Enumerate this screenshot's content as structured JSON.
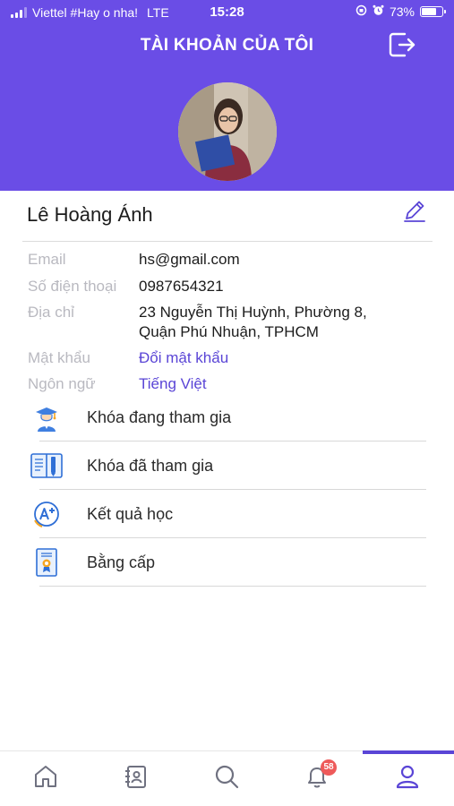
{
  "status_bar": {
    "carrier": "Viettel #Hay o nha!",
    "network": "LTE",
    "time": "15:28",
    "battery": "73%",
    "battery_level": 0.73
  },
  "header": {
    "title": "TÀI KHOẢN CỦA TÔI",
    "logout_icon": "logout-icon"
  },
  "profile": {
    "name": "Lê Hoàng Ánh",
    "edit_icon": "pencil-icon"
  },
  "info": {
    "email_label": "Email",
    "email": "hs@gmail.com",
    "phone_label": "Số điện thoại",
    "phone": "0987654321",
    "address_label": "Địa chỉ",
    "address_line1": "23 Nguyễn Thị Huỳnh, Phường 8,",
    "address_line2": "Quận Phú Nhuận, TPHCM",
    "password_label": "Mật khẩu",
    "password_action": "Đổi mật khẩu",
    "language_label": "Ngôn ngữ",
    "language": "Tiếng Việt"
  },
  "menu": [
    {
      "label": "Khóa đang tham gia",
      "icon": "graduate-icon"
    },
    {
      "label": "Khóa đã tham gia",
      "icon": "book-icon"
    },
    {
      "label": "Kết quả học",
      "icon": "grade-a-plus-icon"
    },
    {
      "label": "Bằng cấp",
      "icon": "certificate-icon"
    }
  ],
  "tabbar": {
    "tabs": [
      "home-icon",
      "contact-book-icon",
      "search-icon",
      "bell-icon",
      "user-icon"
    ],
    "notification_count": "58",
    "active_tab": "user-icon"
  },
  "colors": {
    "accent": "#6a4de6",
    "link": "#5a45d6",
    "label_gray": "#b9b9c0",
    "badge": "#ee5a5a"
  }
}
